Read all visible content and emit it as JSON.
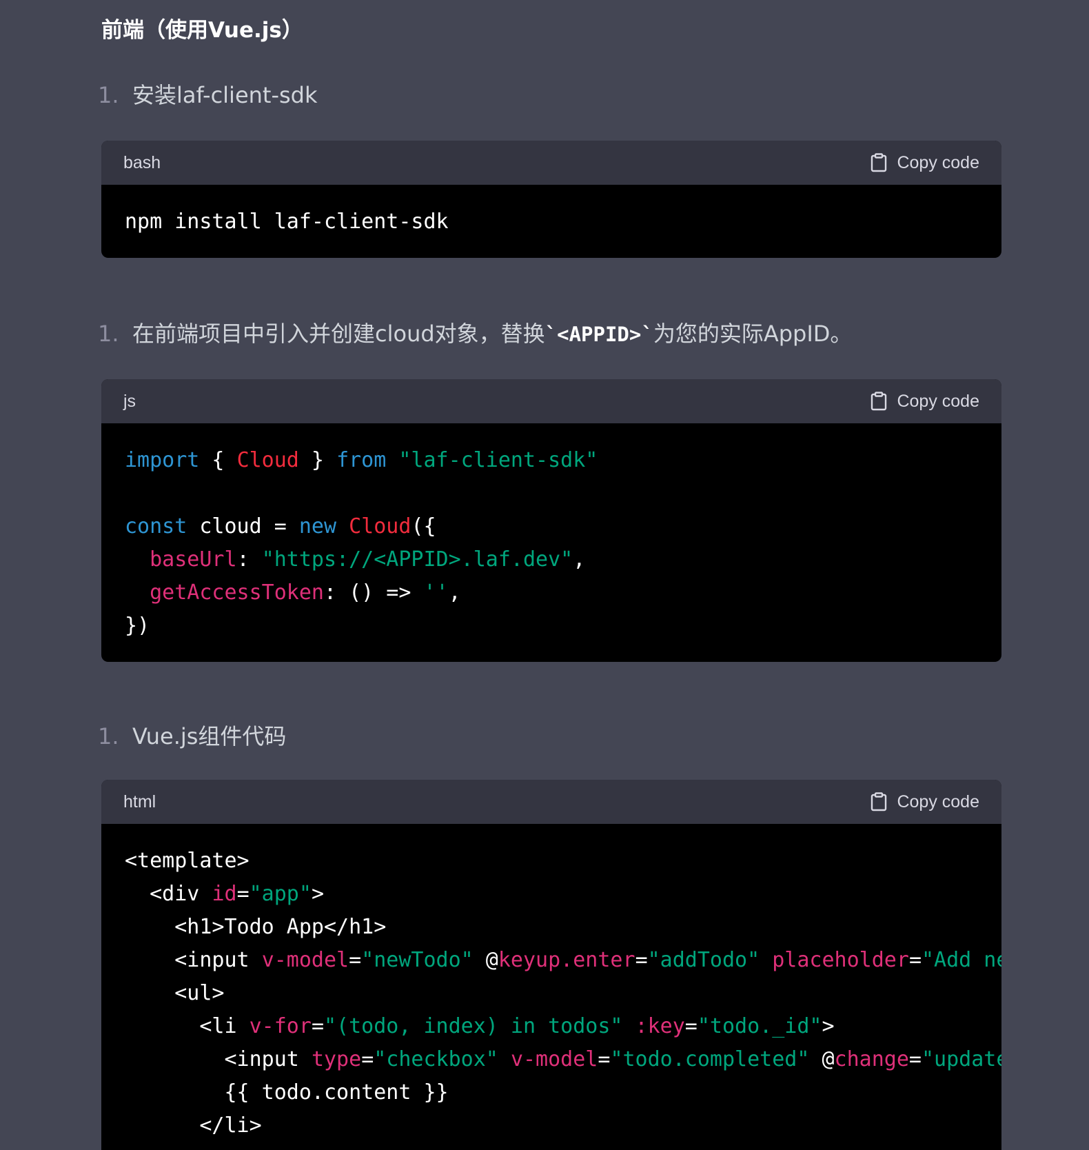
{
  "heading": "前端（使用Vue.js）",
  "copy_label": "Copy code",
  "steps": [
    {
      "num": "1.",
      "text": "安装laf-client-sdk"
    },
    {
      "num": "1.",
      "text_before": "在前端项目中引入并创建cloud对象，替换",
      "code": "`<APPID>`",
      "text_after": "为您的实际AppID。"
    },
    {
      "num": "1.",
      "text": "Vue.js组件代码"
    }
  ],
  "blocks": [
    {
      "lang": "bash"
    },
    {
      "lang": "js"
    },
    {
      "lang": "html"
    }
  ],
  "code": {
    "bash": [
      [
        [
          "txt",
          "npm install laf-client-sdk"
        ]
      ]
    ],
    "js": [
      [
        [
          "kw",
          "import"
        ],
        [
          "txt",
          " { "
        ],
        [
          "cls",
          "Cloud"
        ],
        [
          "txt",
          " } "
        ],
        [
          "kw",
          "from"
        ],
        [
          "txt",
          " "
        ],
        [
          "str",
          "\"laf-client-sdk\""
        ]
      ],
      [],
      [
        [
          "kw",
          "const"
        ],
        [
          "txt",
          " cloud = "
        ],
        [
          "kw",
          "new"
        ],
        [
          "txt",
          " "
        ],
        [
          "cls",
          "Cloud"
        ],
        [
          "txt",
          "({"
        ]
      ],
      [
        [
          "txt",
          "  "
        ],
        [
          "prop",
          "baseUrl"
        ],
        [
          "txt",
          ": "
        ],
        [
          "str",
          "\"https://<APPID>.laf.dev\""
        ],
        [
          "txt",
          ","
        ]
      ],
      [
        [
          "txt",
          "  "
        ],
        [
          "prop",
          "getAccessToken"
        ],
        [
          "txt",
          ": () => "
        ],
        [
          "str",
          "''"
        ],
        [
          "txt",
          ","
        ]
      ],
      [
        [
          "txt",
          "})"
        ]
      ]
    ],
    "html": [
      [
        [
          "txt",
          "<template>"
        ]
      ],
      [
        [
          "txt",
          "  <div "
        ],
        [
          "prop",
          "id"
        ],
        [
          "txt",
          "="
        ],
        [
          "str",
          "\"app\""
        ],
        [
          "txt",
          ">"
        ]
      ],
      [
        [
          "txt",
          "    <h1>Todo App</h1>"
        ]
      ],
      [
        [
          "txt",
          "    <input "
        ],
        [
          "prop",
          "v-model"
        ],
        [
          "txt",
          "="
        ],
        [
          "str",
          "\"newTodo\""
        ],
        [
          "txt",
          " @"
        ],
        [
          "prop",
          "keyup.enter"
        ],
        [
          "txt",
          "="
        ],
        [
          "str",
          "\"addTodo\""
        ],
        [
          "txt",
          " "
        ],
        [
          "prop",
          "placeholder"
        ],
        [
          "txt",
          "="
        ],
        [
          "str",
          "\"Add new tod"
        ]
      ],
      [
        [
          "txt",
          "    <ul>"
        ]
      ],
      [
        [
          "txt",
          "      <li "
        ],
        [
          "prop",
          "v-for"
        ],
        [
          "txt",
          "="
        ],
        [
          "str",
          "\"(todo, index) in todos\""
        ],
        [
          "txt",
          " "
        ],
        [
          "prop",
          ":key"
        ],
        [
          "txt",
          "="
        ],
        [
          "str",
          "\"todo._id\""
        ],
        [
          "txt",
          ">"
        ]
      ],
      [
        [
          "txt",
          "        <input "
        ],
        [
          "prop",
          "type"
        ],
        [
          "txt",
          "="
        ],
        [
          "str",
          "\"checkbox\""
        ],
        [
          "txt",
          " "
        ],
        [
          "prop",
          "v-model"
        ],
        [
          "txt",
          "="
        ],
        [
          "str",
          "\"todo.completed\""
        ],
        [
          "txt",
          " @"
        ],
        [
          "prop",
          "change"
        ],
        [
          "txt",
          "="
        ],
        [
          "str",
          "\"updateTodo("
        ]
      ],
      [
        [
          "txt",
          "        {{ todo.content }}"
        ]
      ],
      [
        [
          "txt",
          "      </li>"
        ]
      ]
    ]
  }
}
